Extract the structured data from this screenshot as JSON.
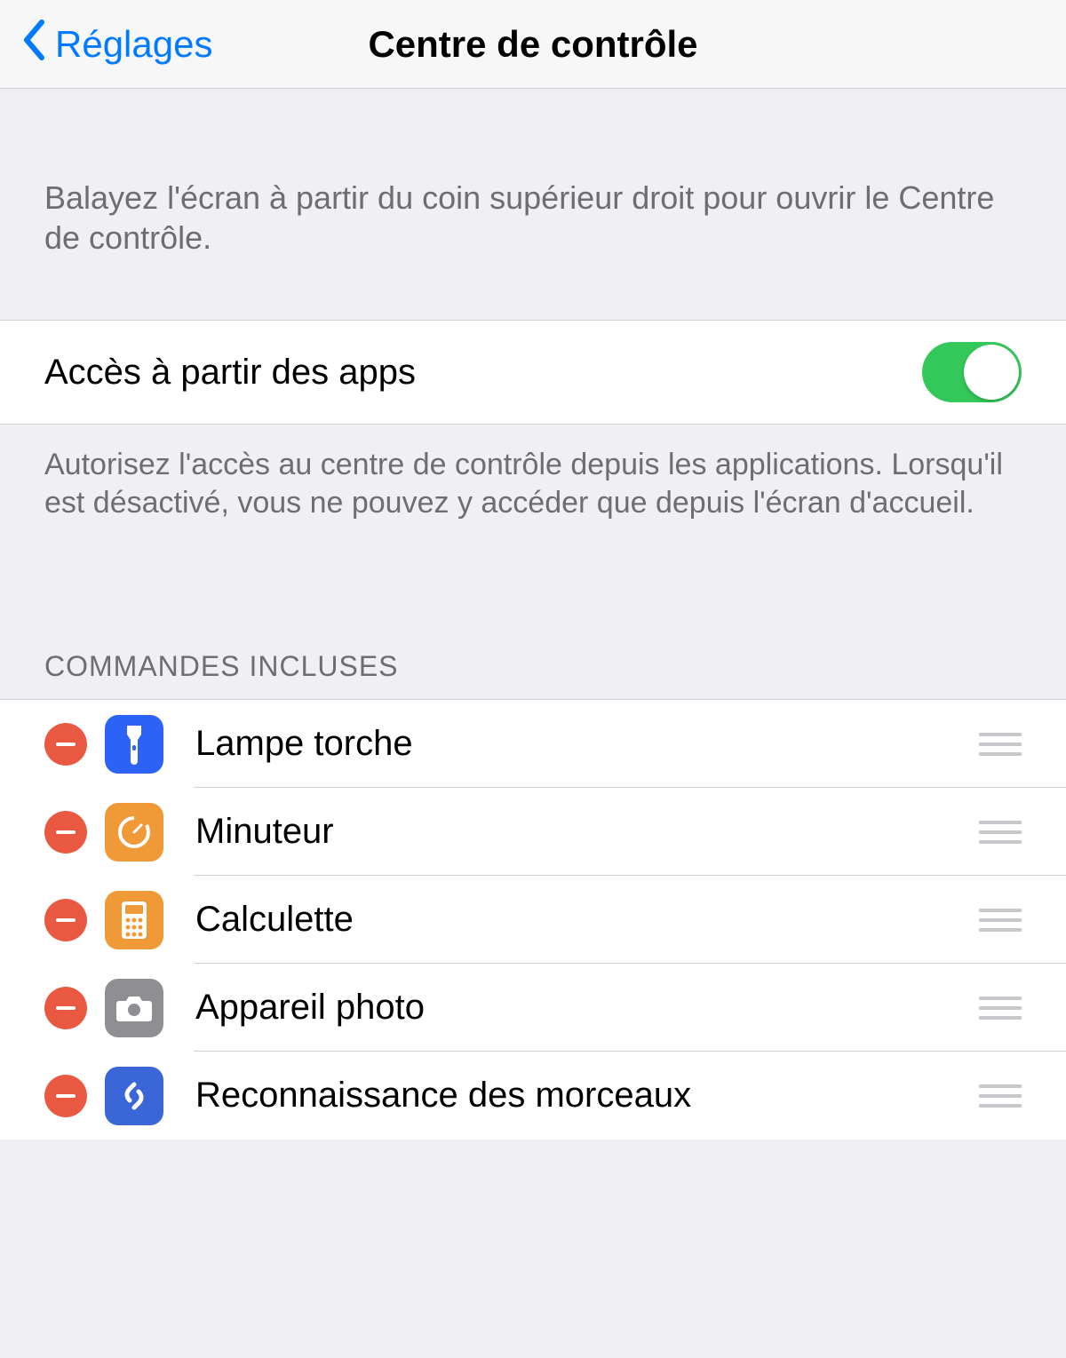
{
  "header": {
    "back_label": "Réglages",
    "title": "Centre de contrôle"
  },
  "intro": "Balayez l'écran à partir du coin supérieur droit pour ouvrir le Centre de contrôle.",
  "access_row": {
    "label": "Accès à partir des apps",
    "enabled": true
  },
  "access_footer": "Autorisez l'accès au centre de contrôle depuis les applications. Lorsqu'il est désactivé, vous ne pouvez y accéder que depuis l'écran d'accueil.",
  "included_section_header": "COMMANDES INCLUSES",
  "included": [
    {
      "label": "Lampe torche",
      "icon": "flashlight-icon",
      "icon_color": "#2d62f6"
    },
    {
      "label": "Minuteur",
      "icon": "timer-icon",
      "icon_color": "#f09a37"
    },
    {
      "label": "Calculette",
      "icon": "calculator-icon",
      "icon_color": "#f09a37"
    },
    {
      "label": "Appareil photo",
      "icon": "camera-icon",
      "icon_color": "#8e8e93"
    },
    {
      "label": "Reconnaissance des morceaux",
      "icon": "shazam-icon",
      "icon_color": "#3a66d8"
    }
  ]
}
